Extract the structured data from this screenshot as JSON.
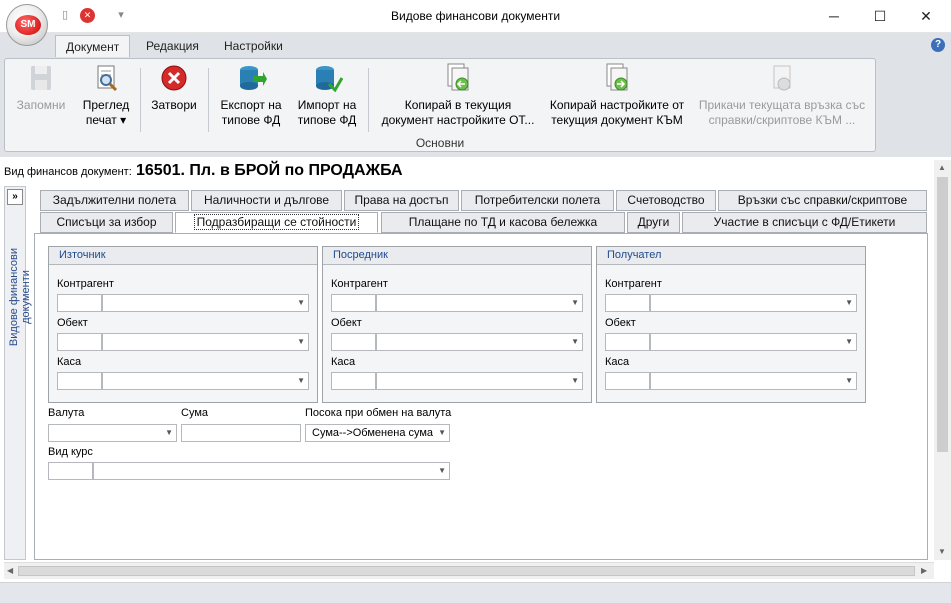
{
  "window": {
    "title": "Видове финансови документи"
  },
  "ribbon_tabs": [
    "Документ",
    "Редакция",
    "Настройки"
  ],
  "ribbon": {
    "buttons": [
      {
        "label1": "Запомни",
        "label2": "",
        "icon": "save-icon",
        "enabled": false
      },
      {
        "label1": "Преглед",
        "label2": "печат ▾",
        "icon": "print-preview-icon",
        "enabled": true
      },
      {
        "label1": "Затвори",
        "label2": "",
        "icon": "close-icon",
        "enabled": true
      },
      {
        "label1": "Експорт на",
        "label2": "типове ФД",
        "icon": "export-db-icon",
        "enabled": true
      },
      {
        "label1": "Импорт на",
        "label2": "типове ФД",
        "icon": "import-db-icon",
        "enabled": true
      },
      {
        "label1": "Копирай в текущия",
        "label2": "документ настройките ОТ...",
        "icon": "copy-from-icon",
        "enabled": true
      },
      {
        "label1": "Копирай настройките от",
        "label2": "текущия документ КЪМ",
        "icon": "copy-to-icon",
        "enabled": true
      },
      {
        "label1": "Прикачи текущата връзка със",
        "label2": "справки/скриптове КЪМ ...",
        "icon": "attach-icon",
        "enabled": false
      }
    ],
    "group": "Основни"
  },
  "doc": {
    "label": "Вид финансов документ:",
    "value": "16501. Пл. в БРОЙ по ПРОДАЖБА"
  },
  "sidebar": {
    "label": "Видове финансови документи"
  },
  "tabs_row1": [
    "Задължителни полета",
    "Наличности и дългове",
    "Права на достъп",
    "Потребителски полета",
    "Счетоводство",
    "Връзки със справки/скриптове"
  ],
  "tabs_row2": [
    "Списъци за избор",
    "Подразбиращи се стойности",
    "Плащане по ТД и касова бележка",
    "Други",
    "Участие в списъци с ФД/Етикети"
  ],
  "groups": [
    {
      "title": "Източник",
      "fields": [
        "Контрагент",
        "Обект",
        "Каса"
      ]
    },
    {
      "title": "Посредник",
      "fields": [
        "Контрагент",
        "Обект",
        "Каса"
      ]
    },
    {
      "title": "Получател",
      "fields": [
        "Контрагент",
        "Обект",
        "Каса"
      ]
    }
  ],
  "bottom": {
    "currency_label": "Валута",
    "amount_label": "Сума",
    "direction_label": "Посока при обмен на валута",
    "direction_value": "Сума-->Обменена сума",
    "rate_type_label": "Вид курс"
  }
}
